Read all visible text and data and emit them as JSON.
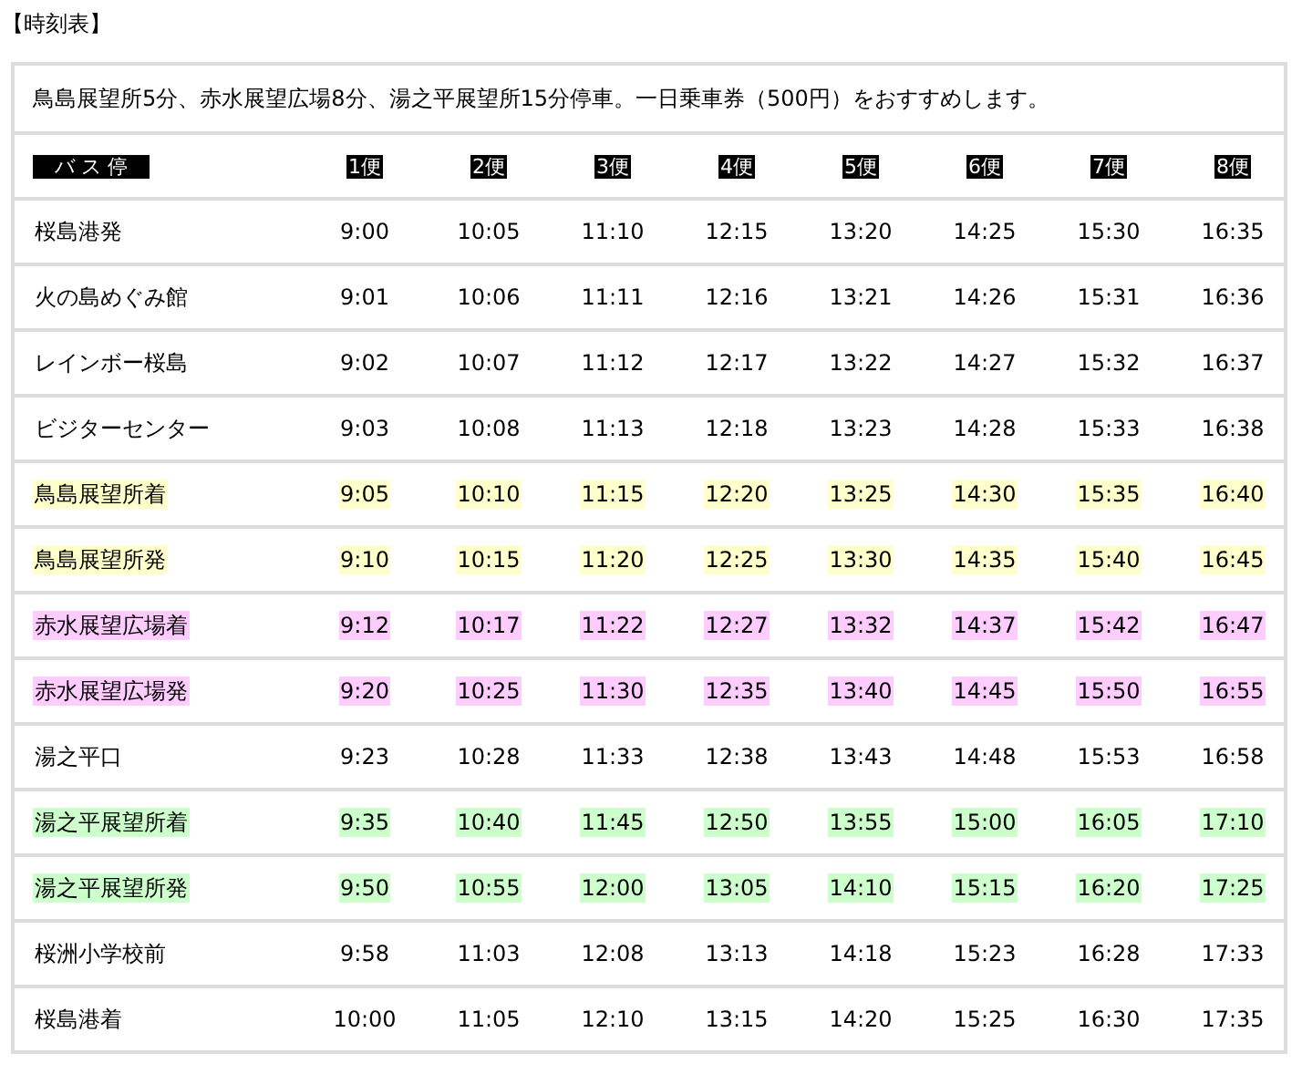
{
  "title": "【時刻表】",
  "note": "鳥島展望所5分、赤水展望広場8分、湯之平展望所15分停車。一日乗車券（500円）をおすすめします。",
  "table": {
    "columns": [
      "　バ ス 停　",
      "1便",
      "2便",
      "3便",
      "4便",
      "5便",
      "6便",
      "7便",
      "8便"
    ],
    "rows": [
      {
        "stop": "桜島港発",
        "times": [
          "9:00",
          "10:05",
          "11:10",
          "12:15",
          "13:20",
          "14:25",
          "15:30",
          "16:35"
        ]
      },
      {
        "stop": "火の島めぐみ館",
        "times": [
          "9:01",
          "10:06",
          "11:11",
          "12:16",
          "13:21",
          "14:26",
          "15:31",
          "16:36"
        ]
      },
      {
        "stop": "レインボー桜島",
        "times": [
          "9:02",
          "10:07",
          "11:12",
          "12:17",
          "13:22",
          "14:27",
          "15:32",
          "16:37"
        ]
      },
      {
        "stop": "ビジターセンター",
        "times": [
          "9:03",
          "10:08",
          "11:13",
          "12:18",
          "13:23",
          "14:28",
          "15:33",
          "16:38"
        ]
      },
      {
        "stop": "鳥島展望所着",
        "color": "#ffffcc",
        "times": [
          "9:05",
          "10:10",
          "11:15",
          "12:20",
          "13:25",
          "14:30",
          "15:35",
          "16:40"
        ]
      },
      {
        "stop": "鳥島展望所発",
        "color": "#ffffcc",
        "times": [
          "9:10",
          "10:15",
          "11:20",
          "12:25",
          "13:30",
          "14:35",
          "15:40",
          "16:45"
        ]
      },
      {
        "stop": "赤水展望広場着",
        "color": "#ffccff",
        "times": [
          "9:12",
          "10:17",
          "11:22",
          "12:27",
          "13:32",
          "14:37",
          "15:42",
          "16:47"
        ]
      },
      {
        "stop": "赤水展望広場発",
        "color": "#ffccff",
        "times": [
          "9:20",
          "10:25",
          "11:30",
          "12:35",
          "13:40",
          "14:45",
          "15:50",
          "16:55"
        ]
      },
      {
        "stop": "湯之平口",
        "times": [
          "9:23",
          "10:28",
          "11:33",
          "12:38",
          "13:43",
          "14:48",
          "15:53",
          "16:58"
        ]
      },
      {
        "stop": "湯之平展望所着",
        "color": "#ccffcc",
        "times": [
          "9:35",
          "10:40",
          "11:45",
          "12:50",
          "13:55",
          "15:00",
          "16:05",
          "17:10"
        ]
      },
      {
        "stop": "湯之平展望所発",
        "color": "#ccffcc",
        "times": [
          "9:50",
          "10:55",
          "12:00",
          "13:05",
          "14:10",
          "15:15",
          "16:20",
          "17:25"
        ]
      },
      {
        "stop": "桜洲小学校前",
        "times": [
          "9:58",
          "11:03",
          "12:08",
          "13:13",
          "14:18",
          "15:23",
          "16:28",
          "17:33"
        ]
      },
      {
        "stop": "桜島港着",
        "times": [
          "10:00",
          "11:05",
          "12:10",
          "13:15",
          "14:20",
          "15:25",
          "16:30",
          "17:35"
        ]
      }
    ]
  }
}
